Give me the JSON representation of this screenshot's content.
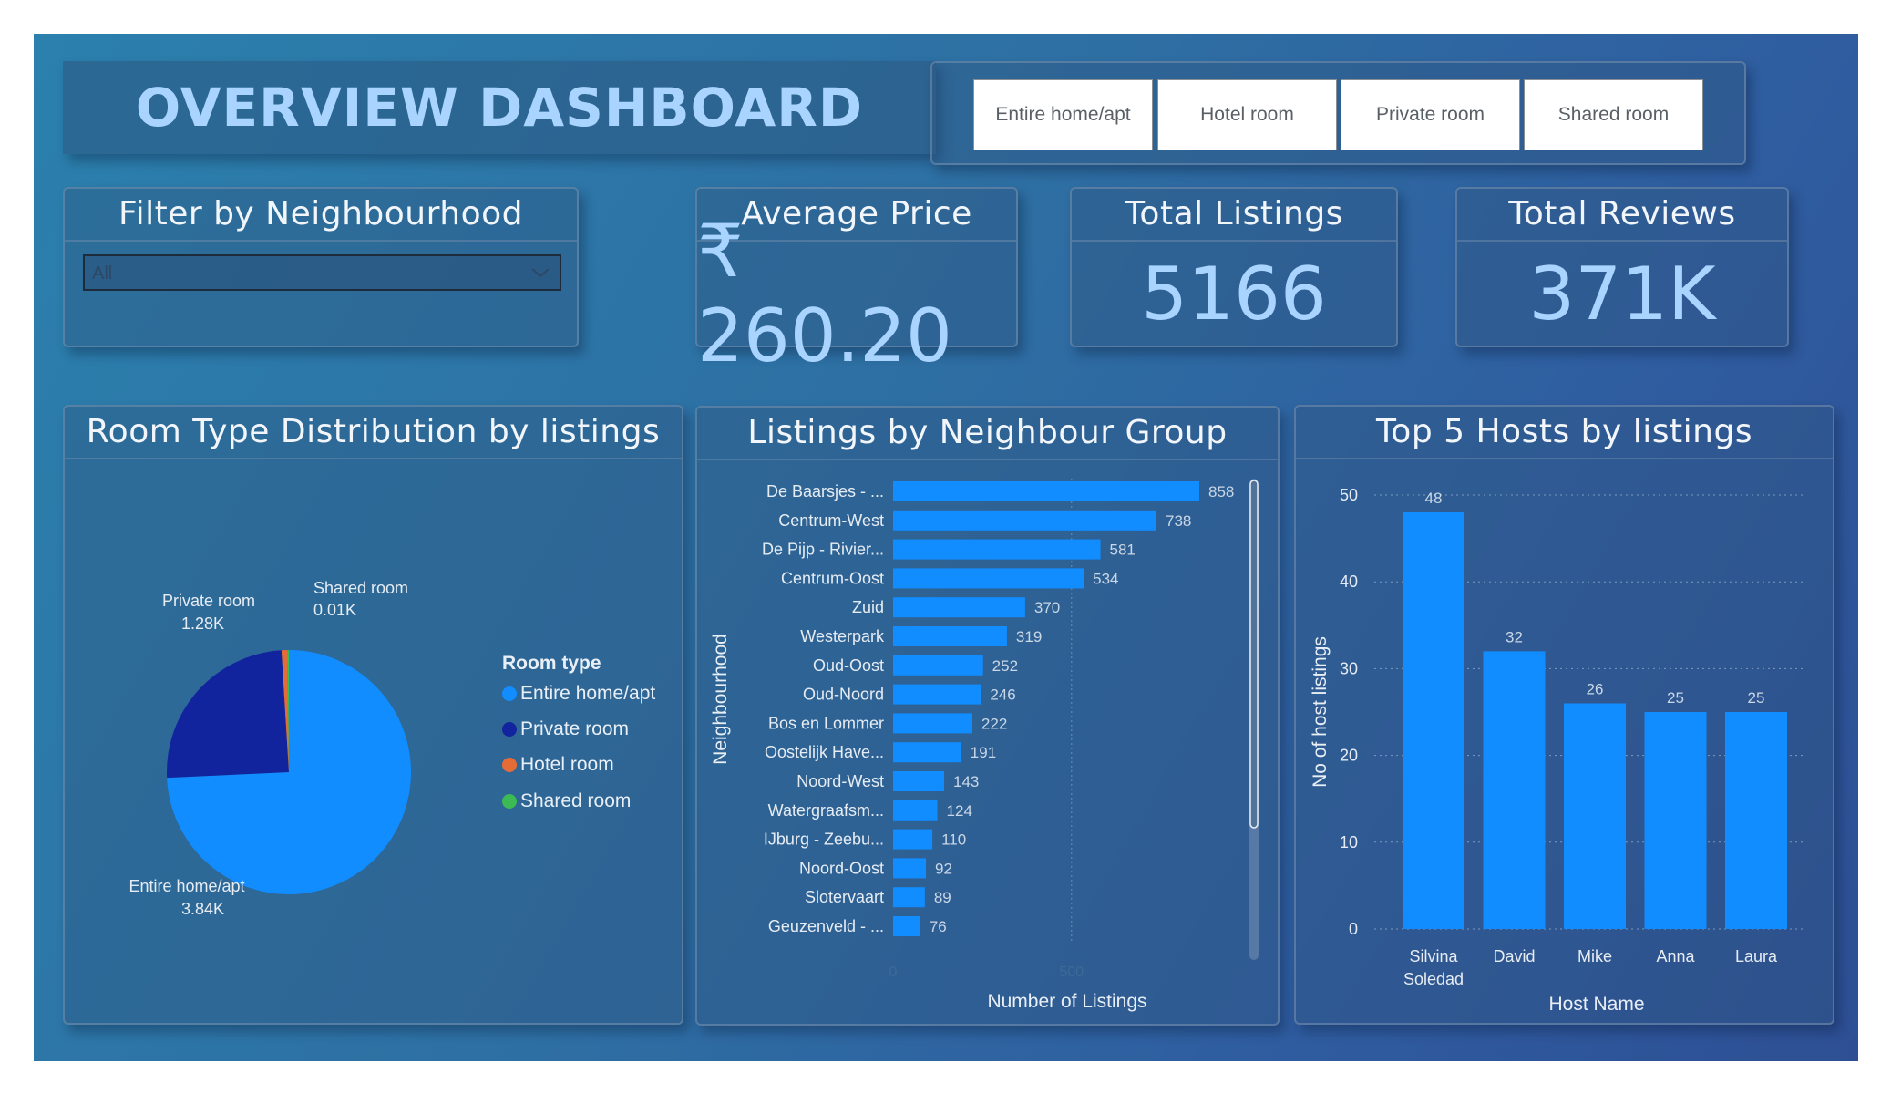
{
  "title": "OVERVIEW DASHBOARD",
  "room_type_slicer": {
    "options": [
      "Entire home/apt",
      "Hotel room",
      "Private room",
      "Shared room"
    ]
  },
  "neighbourhood_filter": {
    "title": "Filter by Neighbourhood",
    "selected": "All"
  },
  "kpis": {
    "avg_price": {
      "title": "Average Price",
      "value": "₹ 260.20"
    },
    "total_listings": {
      "title": "Total Listings",
      "value": "5166"
    },
    "total_reviews": {
      "title": "Total Reviews",
      "value": "371K"
    }
  },
  "colors": {
    "entire_home": "#118dff",
    "private_room": "#12239e",
    "hotel_room": "#e66c37",
    "shared_room": "#3cba54",
    "bar": "#118dff",
    "title_text": "#a9d4ff"
  },
  "chart_data": [
    {
      "type": "pie",
      "title": "Room Type Distribution by listings",
      "legend_title": "Room type",
      "legend_position": "right",
      "slices": [
        {
          "name": "Entire home/apt",
          "value": 3.84,
          "label": "3.84K"
        },
        {
          "name": "Private room",
          "value": 1.28,
          "label": "1.28K"
        },
        {
          "name": "Hotel room",
          "value": 0.04,
          "label": ""
        },
        {
          "name": "Shared room",
          "value": 0.01,
          "label": "0.01K"
        }
      ]
    },
    {
      "type": "bar",
      "orientation": "horizontal",
      "title": "Listings by Neighbour Group",
      "xlabel": "Number of Listings",
      "ylabel": "Neighbourhood",
      "xlim": [
        0,
        900
      ],
      "xticks": [
        "0",
        "500"
      ],
      "categories": [
        "De Baarsjes - ...",
        "Centrum-West",
        "De Pijp - Rivier...",
        "Centrum-Oost",
        "Zuid",
        "Westerpark",
        "Oud-Oost",
        "Oud-Noord",
        "Bos en Lommer",
        "Oostelijk Have...",
        "Noord-West",
        "Watergraafsm...",
        "IJburg - Zeebu...",
        "Noord-Oost",
        "Slotervaart",
        "Geuzenveld - ..."
      ],
      "values": [
        858,
        738,
        581,
        534,
        370,
        319,
        252,
        246,
        222,
        191,
        143,
        124,
        110,
        92,
        89,
        76
      ]
    },
    {
      "type": "bar",
      "title": "Top 5 Hosts by listings",
      "xlabel": "Host Name",
      "ylabel": "No of host listings",
      "ylim": [
        0,
        50
      ],
      "yticks": [
        "0",
        "10",
        "20",
        "30",
        "40",
        "50"
      ],
      "grid": true,
      "categories": [
        "Silvina Soledad",
        "David",
        "Mike",
        "Anna",
        "Laura"
      ],
      "values": [
        48,
        32,
        26,
        25,
        25
      ]
    }
  ]
}
